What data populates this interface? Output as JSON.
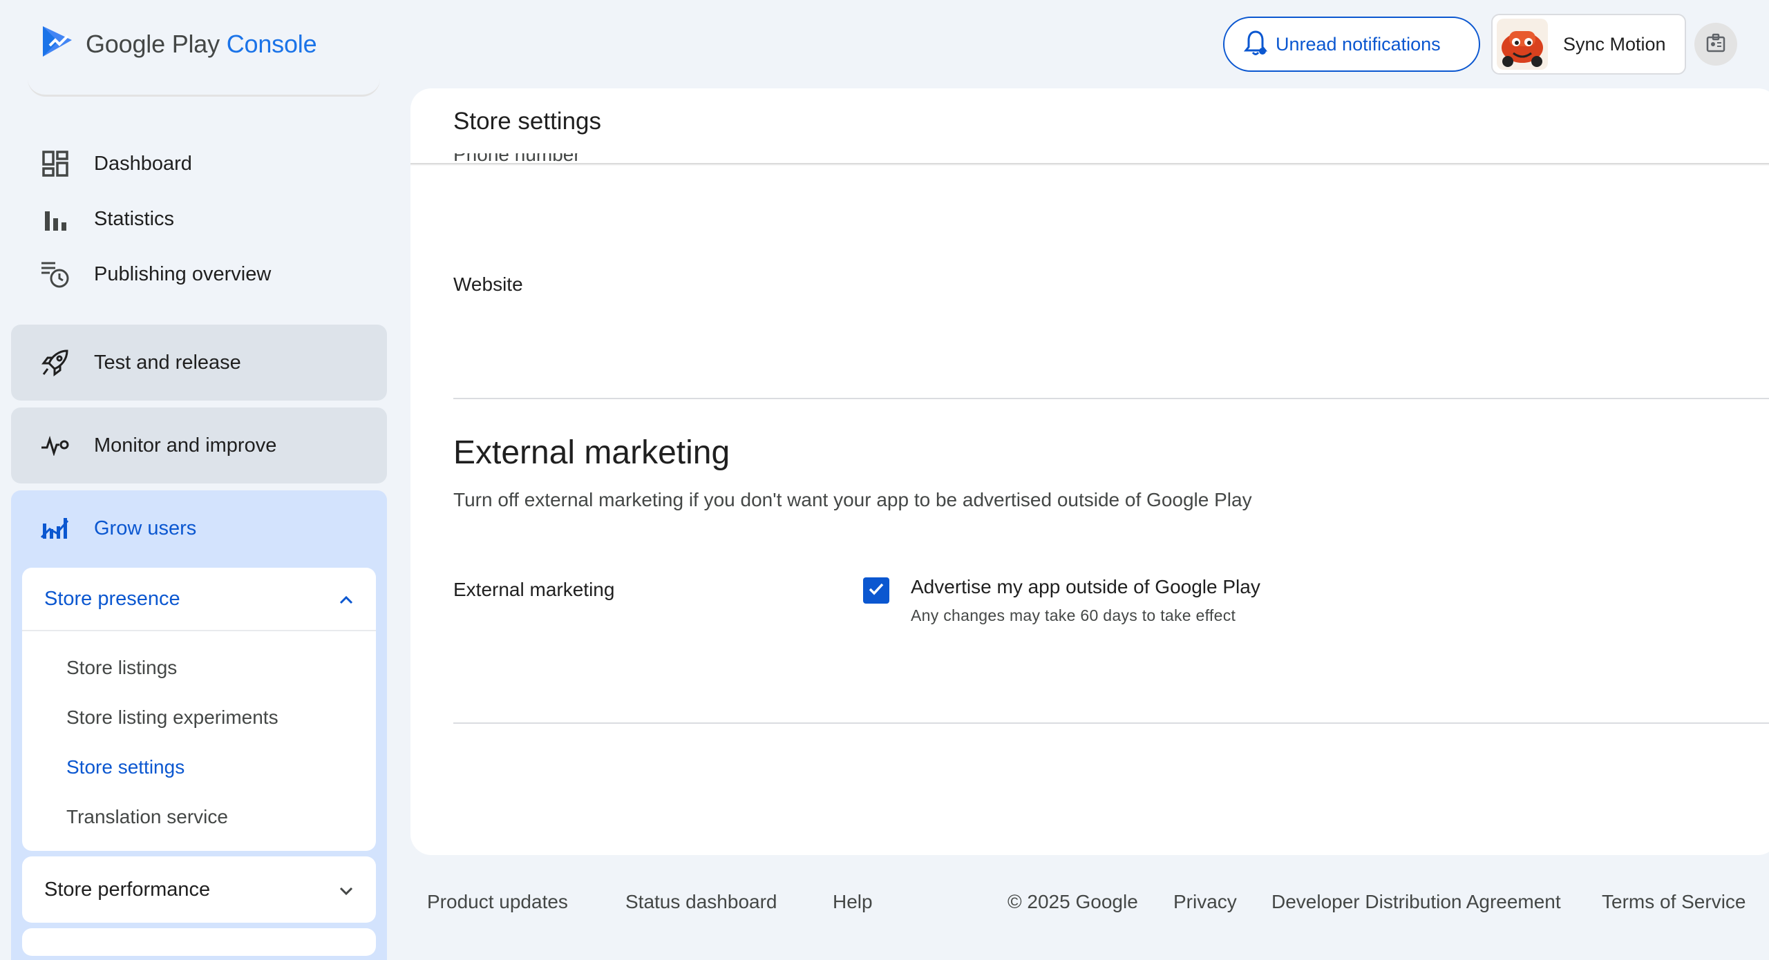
{
  "header": {
    "logo_google": "Google Play",
    "logo_console": "Console",
    "notifications_label": "Unread notifications",
    "account_name": "Sync Motion",
    "icons": {
      "logo": "play-console-logo-icon",
      "bell": "bell-icon",
      "account_switch": "badge-icon"
    }
  },
  "sidebar": {
    "items": [
      {
        "label": "Dashboard",
        "icon": "dashboard-icon"
      },
      {
        "label": "Statistics",
        "icon": "bar-chart-icon"
      },
      {
        "label": "Publishing overview",
        "icon": "publishing-clock-icon"
      }
    ],
    "sections": [
      {
        "label": "Test and release",
        "icon": "rocket-icon"
      },
      {
        "label": "Monitor and improve",
        "icon": "pulse-icon"
      }
    ],
    "grow_users": {
      "label": "Grow users",
      "icon": "growth-chart-icon",
      "store_presence": {
        "label": "Store presence",
        "expanded": true,
        "items": [
          "Store listings",
          "Store listing experiments",
          "Store settings",
          "Translation service"
        ],
        "active": "Store settings"
      },
      "store_performance": {
        "label": "Store performance",
        "expanded": false
      }
    }
  },
  "main": {
    "title": "Store settings",
    "cut_off_label": "Phone number",
    "website_label": "Website",
    "external_marketing": {
      "heading": "External marketing",
      "description": "Turn off external marketing if you don't want your app to be advertised outside of Google Play",
      "field_label": "External marketing",
      "checkbox_label": "Advertise my app outside of Google Play",
      "checkbox_checked": true,
      "checkbox_help": "Any changes may take 60 days to take effect"
    }
  },
  "footer": {
    "links_left": [
      "Product updates",
      "Status dashboard",
      "Help"
    ],
    "copyright": "© 2025 Google",
    "links_right": [
      "Privacy",
      "Developer Distribution Agreement",
      "Terms of Service"
    ]
  },
  "colors": {
    "accent": "#0b57d0",
    "background": "#f0f4f9",
    "grow_users_bg": "#d3e3fd",
    "section_bg": "#dde3ea"
  }
}
